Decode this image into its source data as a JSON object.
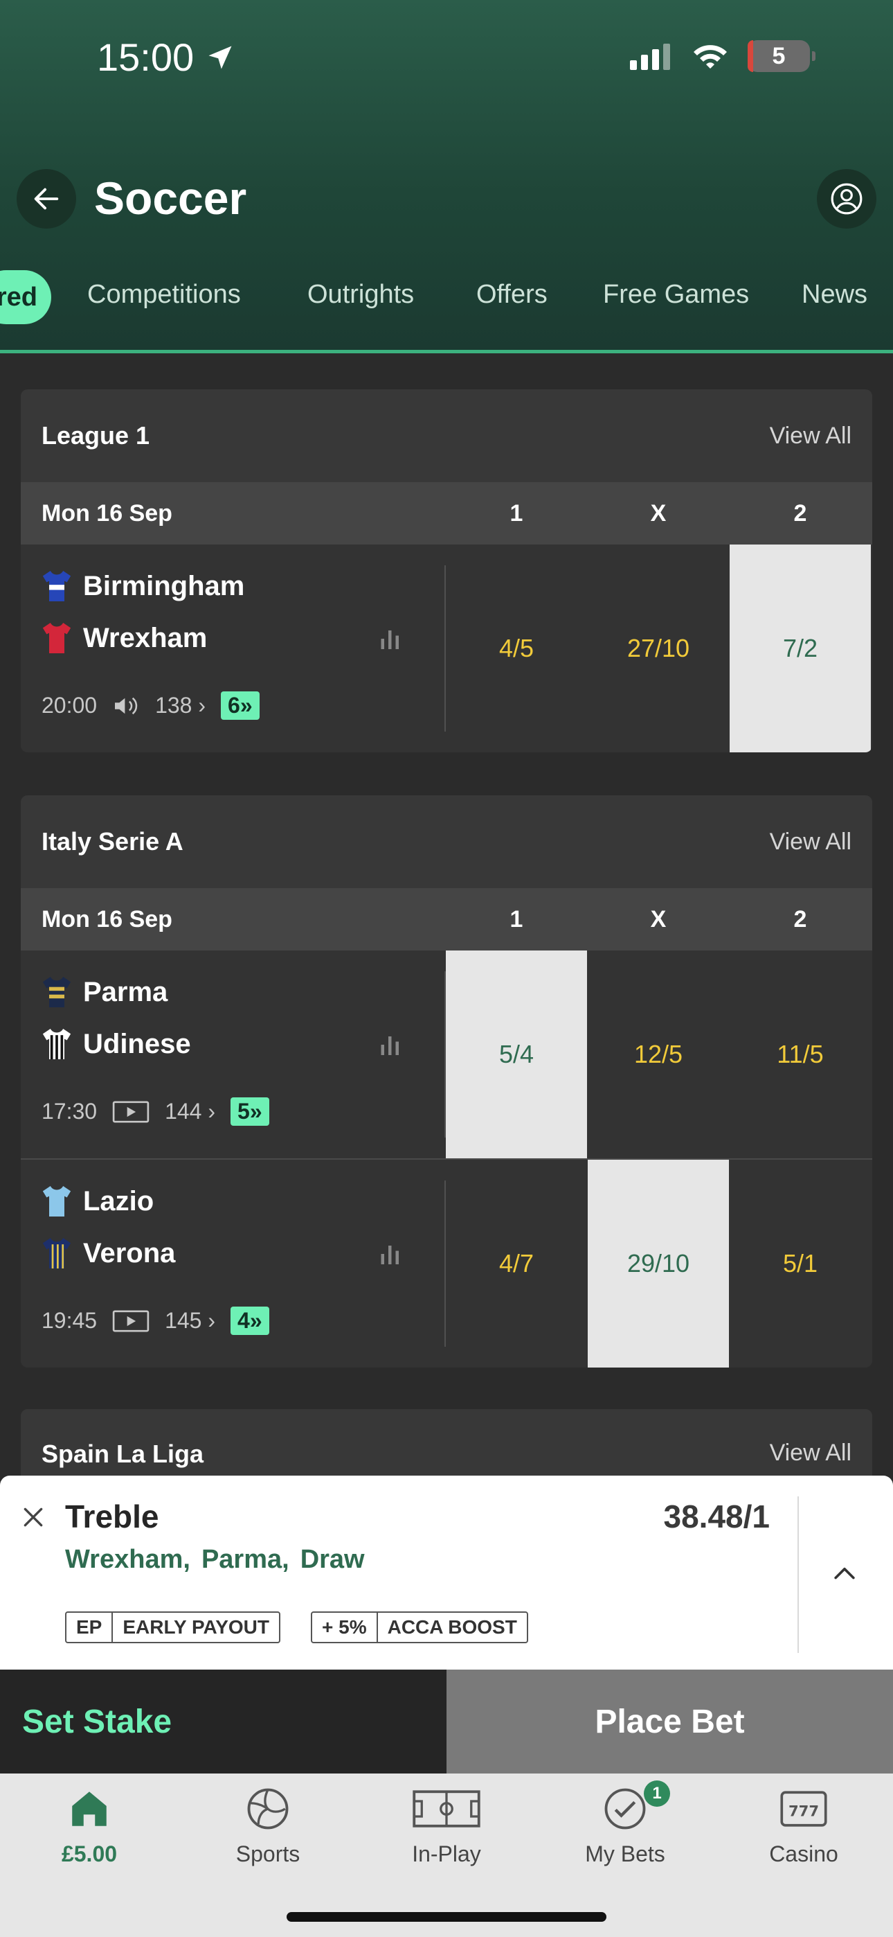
{
  "status": {
    "time": "15:00",
    "battery": "5"
  },
  "header": {
    "title": "Soccer"
  },
  "tabs": {
    "active": "red",
    "items": [
      "Competitions",
      "Outrights",
      "Offers",
      "Free Games",
      "News"
    ]
  },
  "cards": [
    {
      "title": "League 1",
      "view_all": "View All",
      "date": "Mon 16 Sep",
      "cols": [
        "1",
        "X",
        "2"
      ],
      "matches": [
        {
          "home": "Birmingham",
          "away": "Wrexham",
          "time": "20:00",
          "markets": "138",
          "boost": "6",
          "odds": [
            "4/5",
            "27/10",
            "7/2"
          ],
          "selected": 2
        }
      ]
    },
    {
      "title": "Italy Serie A",
      "view_all": "View All",
      "date": "Mon 16 Sep",
      "cols": [
        "1",
        "X",
        "2"
      ],
      "matches": [
        {
          "home": "Parma",
          "away": "Udinese",
          "time": "17:30",
          "markets": "144",
          "boost": "5",
          "odds": [
            "5/4",
            "12/5",
            "11/5"
          ],
          "selected": 0
        },
        {
          "home": "Lazio",
          "away": "Verona",
          "time": "19:45",
          "markets": "145",
          "boost": "4",
          "odds": [
            "4/7",
            "29/10",
            "5/1"
          ],
          "selected": 1
        }
      ]
    },
    {
      "title": "Spain La Liga",
      "view_all": "View All"
    }
  ],
  "betslip": {
    "type": "Treble",
    "odds": "38.48/1",
    "selections": [
      "Wrexham,",
      "Parma,",
      "Draw"
    ],
    "badge1": [
      "EP",
      "EARLY PAYOUT"
    ],
    "badge2": [
      "+ 5%",
      "ACCA BOOST"
    ],
    "set_stake": "Set Stake",
    "place_bet": "Place Bet"
  },
  "nav": [
    {
      "label": "£5.00",
      "icon": "home-icon"
    },
    {
      "label": "Sports",
      "icon": "soccer-ball-icon"
    },
    {
      "label": "In-Play",
      "icon": "pitch-icon"
    },
    {
      "label": "My Bets",
      "icon": "check-circle-icon",
      "badge": "1"
    },
    {
      "label": "Casino",
      "icon": "slot-machine-icon"
    }
  ],
  "colors": {
    "accent": "#6ef0b5",
    "odds": "#f2cb3a",
    "selected_bg": "#e6e6e6",
    "brand_green": "#2f7a56"
  }
}
